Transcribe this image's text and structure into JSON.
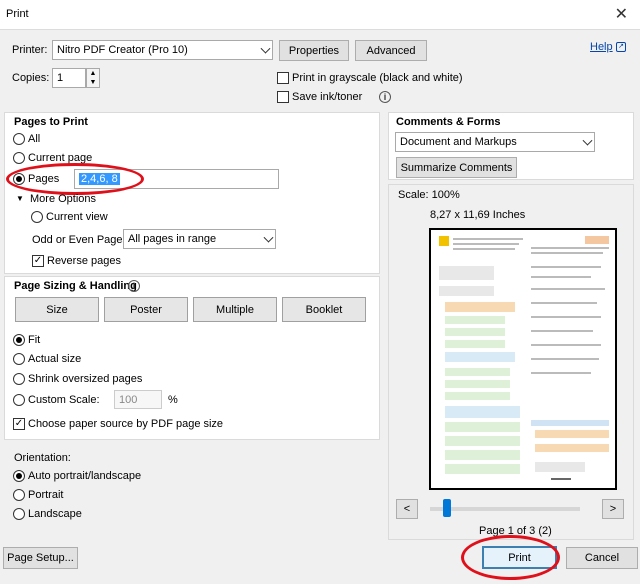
{
  "window": {
    "title": "Print"
  },
  "printer": {
    "label": "Printer:",
    "value": "Nitro PDF Creator (Pro 10)",
    "properties_label": "Properties",
    "advanced_label": "Advanced",
    "help_label": "Help"
  },
  "copies": {
    "label": "Copies:",
    "value": "1"
  },
  "options": {
    "grayscale_label": "Print in grayscale (black and white)",
    "save_ink_label": "Save ink/toner"
  },
  "pages_to_print": {
    "heading": "Pages to Print",
    "all_label": "All",
    "current_page_label": "Current page",
    "pages_label": "Pages",
    "pages_value": "2,4,6, 8",
    "more_options_label": "More Options",
    "current_view_label": "Current view",
    "odd_even_label": "Odd or Even Pages:",
    "odd_even_value": "All pages in range",
    "reverse_label": "Reverse pages"
  },
  "sizing": {
    "heading": "Page Sizing & Handling",
    "size_label": "Size",
    "poster_label": "Poster",
    "multiple_label": "Multiple",
    "booklet_label": "Booklet",
    "fit_label": "Fit",
    "actual_size_label": "Actual size",
    "shrink_label": "Shrink oversized pages",
    "custom_scale_label": "Custom Scale:",
    "custom_scale_value": "100",
    "percent": "%",
    "choose_source_label": "Choose paper source by PDF page size"
  },
  "orientation": {
    "heading": "Orientation:",
    "auto_label": "Auto portrait/landscape",
    "portrait_label": "Portrait",
    "landscape_label": "Landscape"
  },
  "comments": {
    "heading": "Comments & Forms",
    "value": "Document and Markups",
    "summarize_label": "Summarize Comments"
  },
  "preview": {
    "scale": "Scale: 100%",
    "dimensions": "8,27 x 11,69 Inches",
    "prev": "<",
    "next": ">",
    "page_indicator": "Page 1 of 3 (2)",
    "slider_position": 0.0
  },
  "footer": {
    "page_setup_label": "Page Setup...",
    "print_label": "Print",
    "cancel_label": "Cancel"
  },
  "accent_color": "#e0101a"
}
